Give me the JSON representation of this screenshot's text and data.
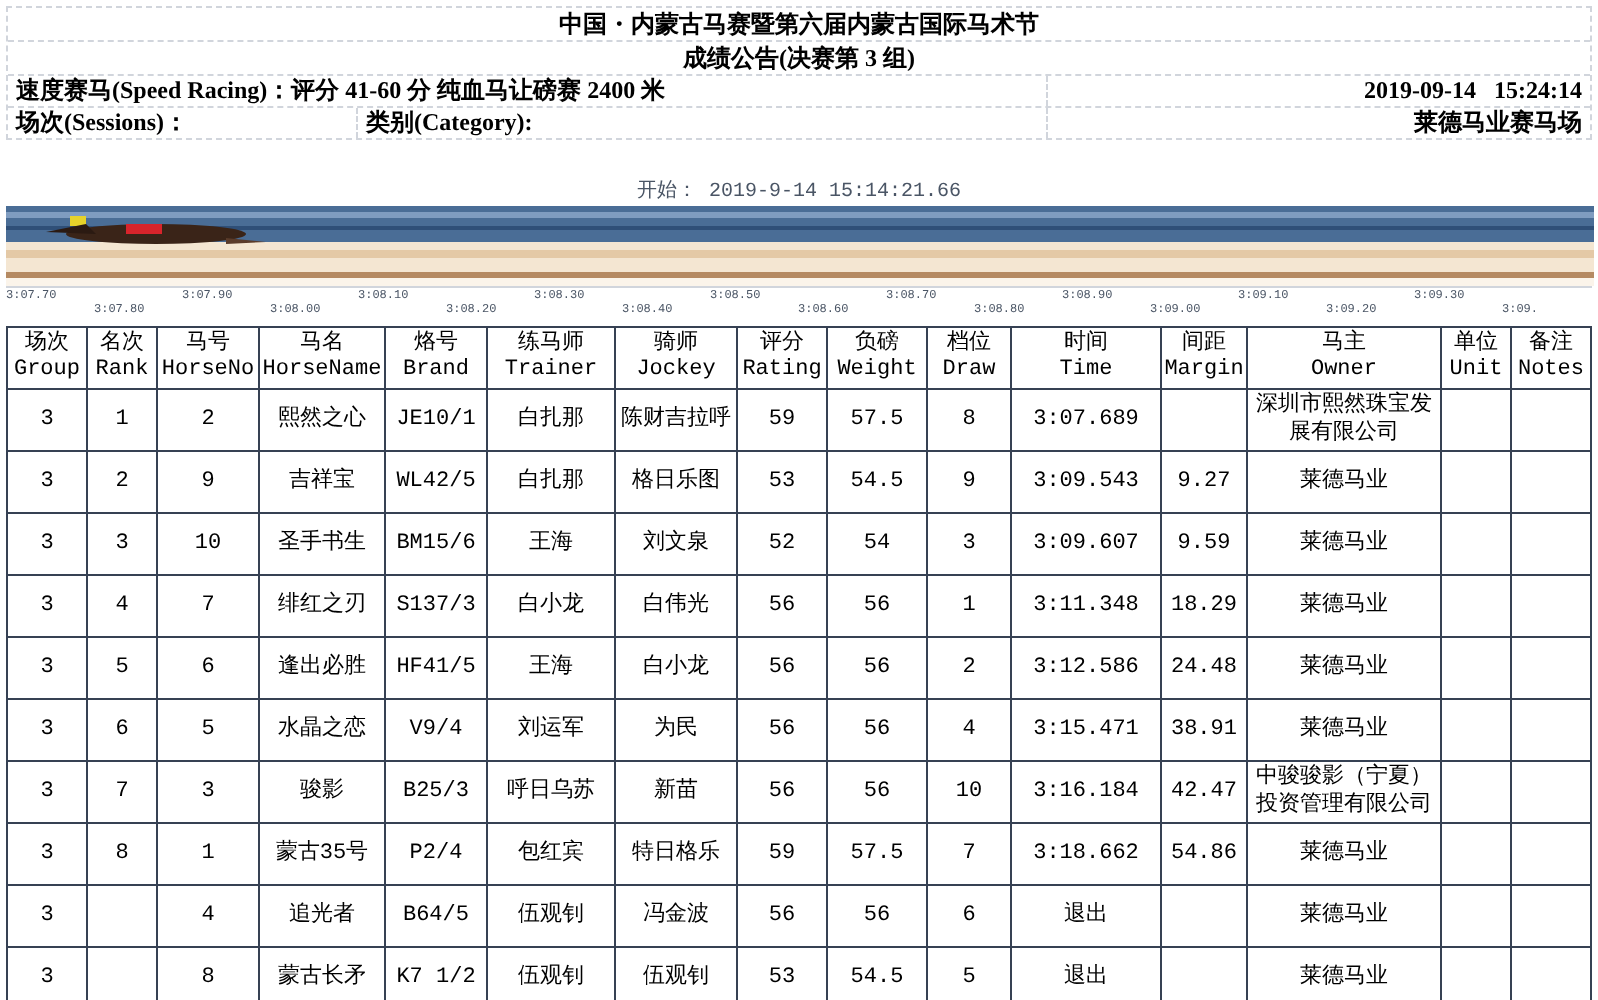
{
  "header": {
    "title": "中国・内蒙古马赛暨第六届内蒙古国际马术节",
    "subtitle": "成绩公告(决赛第 3 组)",
    "race": "速度赛马(Speed Racing)：评分 41-60 分 纯血马让磅赛 2400 米",
    "datetime": "2019-09-14   15:24:14",
    "sessions": "场次(Sessions)：",
    "category": "类别(Category):",
    "venue": "莱德马业赛马场"
  },
  "photo_finish": {
    "start": "开始： 2019-9-14 15:14:21.66",
    "kind": "picture",
    "scale": [
      "3:07.70",
      "3:07.80",
      "3:07.90",
      "3:08.00",
      "3:08.10",
      "3:08.20",
      "3:08.30",
      "3:08.40",
      "3:08.50",
      "3:08.60",
      "3:08.70",
      "3:08.80",
      "3:08.90",
      "3:09.00",
      "3:09.10",
      "3:09.20",
      "3:09.30",
      "3:09."
    ]
  },
  "table": {
    "columns": [
      {
        "cn": "场次",
        "en": "Group"
      },
      {
        "cn": "名次",
        "en": "Rank"
      },
      {
        "cn": "马号",
        "en": "HorseNo"
      },
      {
        "cn": "马名",
        "en": "HorseName"
      },
      {
        "cn": "烙号",
        "en": "Brand"
      },
      {
        "cn": "练马师",
        "en": "Trainer"
      },
      {
        "cn": "骑师",
        "en": "Jockey"
      },
      {
        "cn": "评分",
        "en": "Rating"
      },
      {
        "cn": "负磅",
        "en": "Weight"
      },
      {
        "cn": "档位",
        "en": "Draw"
      },
      {
        "cn": "时间",
        "en": "Time"
      },
      {
        "cn": "间距",
        "en": "Margin"
      },
      {
        "cn": "马主",
        "en": "Owner"
      },
      {
        "cn": "单位",
        "en": "Unit"
      },
      {
        "cn": "备注",
        "en": "Notes"
      }
    ],
    "rows": [
      [
        "3",
        "1",
        "2",
        "熙然之心",
        "JE10/1",
        "白扎那",
        "陈财吉拉呼",
        "59",
        "57.5",
        "8",
        "3:07.689",
        "",
        "深圳市熙然珠宝发展有限公司",
        "",
        ""
      ],
      [
        "3",
        "2",
        "9",
        "吉祥宝",
        "WL42/5",
        "白扎那",
        "格日乐图",
        "53",
        "54.5",
        "9",
        "3:09.543",
        "9.27",
        "莱德马业",
        "",
        ""
      ],
      [
        "3",
        "3",
        "10",
        "圣手书生",
        "BM15/6",
        "王海",
        "刘文泉",
        "52",
        "54",
        "3",
        "3:09.607",
        "9.59",
        "莱德马业",
        "",
        ""
      ],
      [
        "3",
        "4",
        "7",
        "绯红之刃",
        "S137/3",
        "白小龙",
        "白伟光",
        "56",
        "56",
        "1",
        "3:11.348",
        "18.29",
        "莱德马业",
        "",
        ""
      ],
      [
        "3",
        "5",
        "6",
        "逢出必胜",
        "HF41/5",
        "王海",
        "白小龙",
        "56",
        "56",
        "2",
        "3:12.586",
        "24.48",
        "莱德马业",
        "",
        ""
      ],
      [
        "3",
        "6",
        "5",
        "水晶之恋",
        "V9/4",
        "刘运军",
        "为民",
        "56",
        "56",
        "4",
        "3:15.471",
        "38.91",
        "莱德马业",
        "",
        ""
      ],
      [
        "3",
        "7",
        "3",
        "骏影",
        "B25/3",
        "呼日乌苏",
        "新苗",
        "56",
        "56",
        "10",
        "3:16.184",
        "42.47",
        "中骏骏影（宁夏）投资管理有限公司",
        "",
        ""
      ],
      [
        "3",
        "8",
        "1",
        "蒙古35号",
        "P2/4",
        "包红宾",
        "特日格乐",
        "59",
        "57.5",
        "7",
        "3:18.662",
        "54.86",
        "莱德马业",
        "",
        ""
      ],
      [
        "3",
        "",
        "4",
        "追光者",
        "B64/5",
        "伍观钊",
        "冯金波",
        "56",
        "56",
        "6",
        "退出",
        "",
        "莱德马业",
        "",
        ""
      ],
      [
        "3",
        "",
        "8",
        "蒙古长矛",
        "K7 1/2",
        "伍观钊",
        "伍观钊",
        "53",
        "54.5",
        "5",
        "退出",
        "",
        "莱德马业",
        "",
        ""
      ]
    ]
  }
}
